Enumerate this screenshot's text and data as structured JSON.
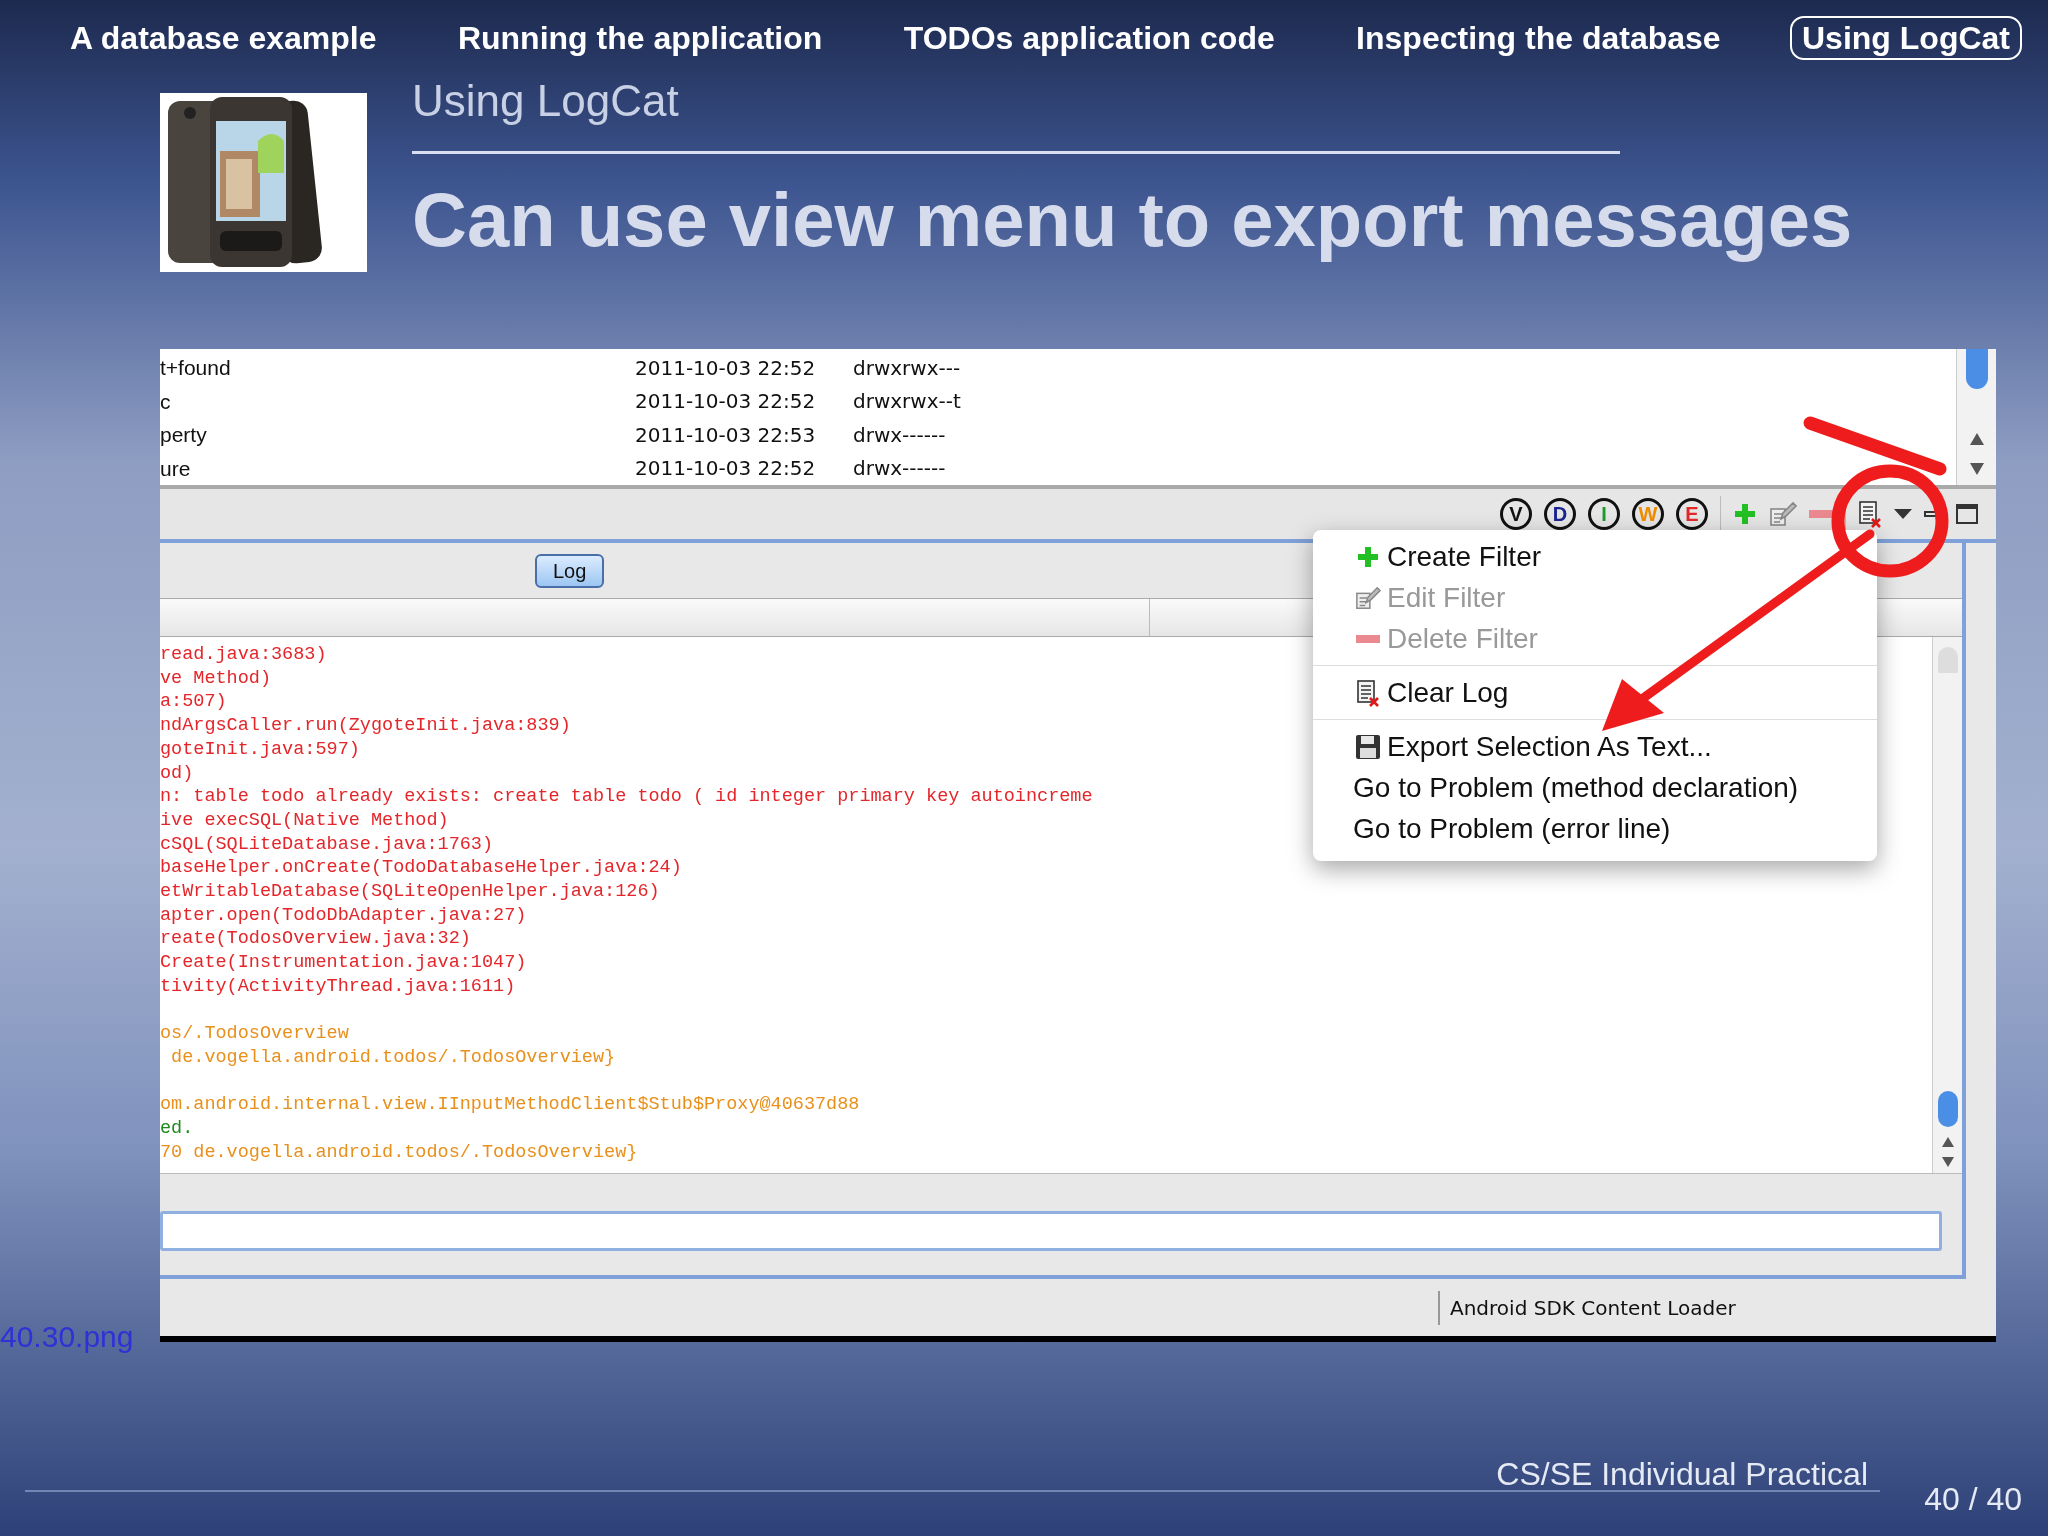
{
  "nav": [
    {
      "label": "A database example",
      "selected": false
    },
    {
      "label": "Running the application",
      "selected": false
    },
    {
      "label": "TODOs application code",
      "selected": false
    },
    {
      "label": "Inspecting the database",
      "selected": false
    },
    {
      "label": "Using LogCat",
      "selected": true
    }
  ],
  "header": {
    "subtitle": "Using LogCat",
    "title": "Can use view menu to export messages"
  },
  "screenshot": {
    "file_rows": [
      {
        "name": "t+found",
        "date": "2011-10-03 22:52",
        "permissions": "drwxrwx---"
      },
      {
        "name": "c",
        "date": "2011-10-03 22:52",
        "permissions": "drwxrwx--t"
      },
      {
        "name": "perty",
        "date": "2011-10-03 22:53",
        "permissions": "drwx------"
      },
      {
        "name": "ure",
        "date": "2011-10-03 22:52",
        "permissions": "drwx------"
      }
    ],
    "level_filters": [
      {
        "label": "V",
        "color": "#111111"
      },
      {
        "label": "D",
        "color": "#1c2490"
      },
      {
        "label": "I",
        "color": "#1e9a2a"
      },
      {
        "label": "W",
        "color": "#f08c00"
      },
      {
        "label": "E",
        "color": "#e42828"
      }
    ],
    "tab": "Log",
    "log_blocks": [
      [
        {
          "text": "read.java:3683)",
          "color": "#e4262a"
        },
        {
          "text": "ve Method)",
          "color": "#e4262a"
        },
        {
          "text": "a:507)",
          "color": "#e4262a"
        },
        {
          "text": "ndArgsCaller.run(ZygoteInit.java:839)",
          "color": "#e4262a"
        },
        {
          "text": "goteInit.java:597)",
          "color": "#e4262a"
        },
        {
          "text": "od)",
          "color": "#e4262a"
        },
        {
          "text": "n: table todo already exists: create table todo ( id integer primary key autoincreme",
          "color": "#e4262a"
        },
        {
          "text": "ive execSQL(Native Method)",
          "color": "#e4262a"
        },
        {
          "text": "cSQL(SQLiteDatabase.java:1763)",
          "color": "#e4262a"
        },
        {
          "text": "baseHelper.onCreate(TodoDatabaseHelper.java:24)",
          "color": "#e4262a"
        },
        {
          "text": "etWritableDatabase(SQLiteOpenHelper.java:126)",
          "color": "#e4262a"
        },
        {
          "text": "apter.open(TodoDbAdapter.java:27)",
          "color": "#e4262a"
        },
        {
          "text": "reate(TodosOverview.java:32)",
          "color": "#e4262a"
        },
        {
          "text": "Create(Instrumentation.java:1047)",
          "color": "#e4262a"
        },
        {
          "text": "tivity(ActivityThread.java:1611)",
          "color": "#e4262a"
        }
      ],
      [
        {
          "text": "os/.TodosOverview",
          "color": "#e8901c"
        },
        {
          "text": " de.vogella.android.todos/.TodosOverview}",
          "color": "#e8901c"
        }
      ],
      [
        {
          "text": "om.android.internal.view.IInputMethodClient$Stub$Proxy@40637d88",
          "color": "#e8901c"
        },
        {
          "text": "ed.",
          "color": "#1f8a1f"
        },
        {
          "text": "70 de.vogella.android.todos/.TodosOverview}",
          "color": "#e8901c"
        }
      ]
    ],
    "menu": {
      "groups": [
        [
          {
            "label": "Create Filter",
            "kind": "plus",
            "disabled": false
          },
          {
            "label": "Edit Filter",
            "kind": "pencil",
            "disabled": true
          },
          {
            "label": "Delete Filter",
            "kind": "minus",
            "disabled": true
          }
        ],
        [
          {
            "label": "Clear Log",
            "kind": "clear",
            "disabled": false
          }
        ],
        [
          {
            "label": "Export Selection As Text...",
            "kind": "save",
            "disabled": false
          },
          {
            "label": "Go to Problem (method declaration)",
            "kind": "text",
            "disabled": false
          },
          {
            "label": "Go to Problem (error line)",
            "kind": "text",
            "disabled": false
          }
        ]
      ]
    },
    "status": "Android SDK Content Loader"
  },
  "caption": "40.30.png",
  "footer": {
    "title": "CS/SE Individual Practical",
    "page": "40 / 40"
  }
}
